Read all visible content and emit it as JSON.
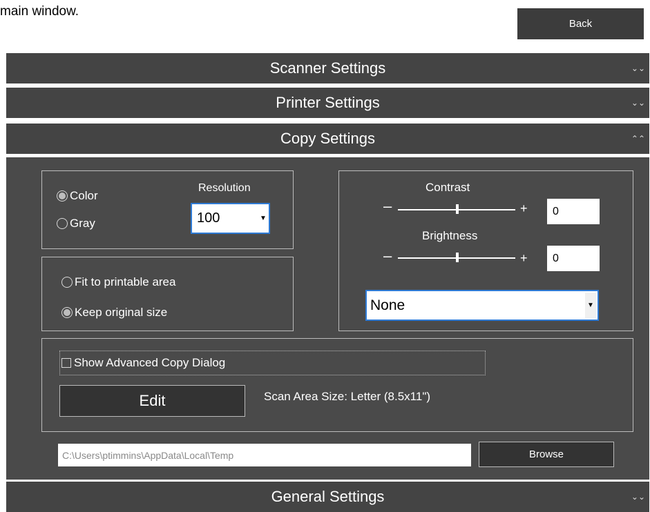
{
  "intro_text": "main window.",
  "back_label": "Back",
  "sections": {
    "scanner": "Scanner Settings",
    "printer": "Printer Settings",
    "copy": "Copy Settings",
    "general": "General Settings"
  },
  "copy": {
    "color_label": "Color",
    "gray_label": "Gray",
    "color_mode_selected": "Color",
    "resolution_label": "Resolution",
    "resolution_value": "100",
    "fit_label": "Fit to printable area",
    "keep_label": "Keep original size",
    "size_mode_selected": "Keep original size",
    "contrast_label": "Contrast",
    "contrast_value": "0",
    "brightness_label": "Brightness",
    "brightness_value": "0",
    "minus_symbol": "–",
    "plus_symbol": "+",
    "filter_value": "None",
    "advanced_label": "Show Advanced Copy Dialog",
    "advanced_checked": false,
    "edit_label": "Edit",
    "scan_area_text": "Scan Area Size:  Letter (8.5x11\")",
    "path_value": "C:\\Users\\ptimmins\\AppData\\Local\\Temp",
    "browse_label": "Browse"
  },
  "icons": {
    "expand": "chevron-double-down-icon",
    "collapse": "chevron-double-up-icon",
    "dropdown": "dropdown-arrow-icon"
  },
  "colors": {
    "panel": "#4a4a4a",
    "header": "#444444",
    "focus_border": "#2e7bd6"
  }
}
